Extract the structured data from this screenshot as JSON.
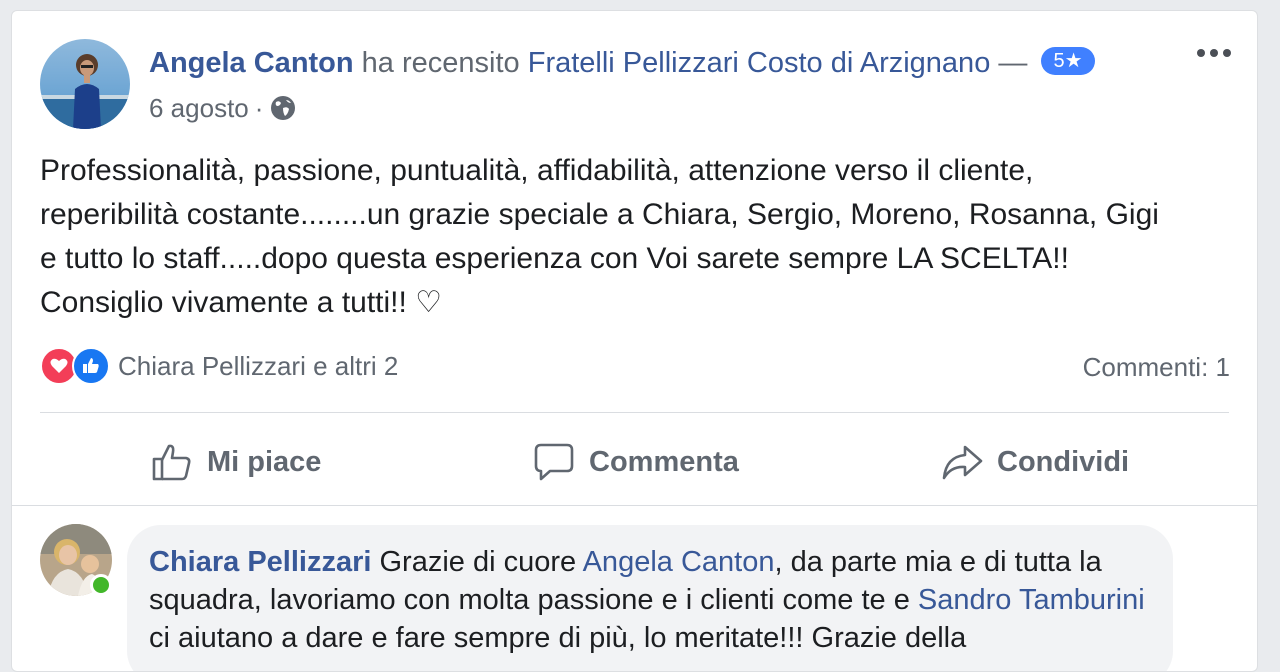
{
  "post": {
    "author": "Angela Canton",
    "action_text": " ha recensito ",
    "page_name": "Fratelli Pellizzari Costo di Arzignano",
    "dash": " — ",
    "rating_badge": "5★",
    "date": "6 agosto",
    "separator": "·",
    "privacy_icon": "globe-icon",
    "review_lines": [
      "Professionalità, passione, puntualità, affidabilità, attenzione verso il cliente,",
      "reperibilità costante........un grazie speciale a Chiara, Sergio, Moreno, Rosanna, Gigi",
      "e tutto lo staff.....dopo questa esperienza con Voi sarete sempre LA SCELTA!!",
      "Consiglio vivamente a tutti!! ♡"
    ]
  },
  "reactions": {
    "summary": "Chiara Pellizzari e altri 2",
    "comments_count": "Commenti: 1",
    "icons": [
      "heart-icon",
      "like-icon"
    ]
  },
  "actions": {
    "like": "Mi piace",
    "comment": "Commenta",
    "share": "Condividi"
  },
  "comment": {
    "author": "Chiara Pellizzari",
    "text_1": " Grazie di cuore ",
    "mention_1": "Angela Canton",
    "text_2": ", da parte mia e di tutta la squadra, lavoriamo con molta passione e i clienti come te e ",
    "mention_2": "Sandro Tamburini",
    "text_3": " ci aiutano a dare e fare sempre di più, lo meritate!!! Grazie della"
  },
  "colors": {
    "link": "#385898",
    "badge": "#4080ff",
    "online": "#42b72a",
    "love": "#f33e58",
    "like": "#1877f2"
  }
}
